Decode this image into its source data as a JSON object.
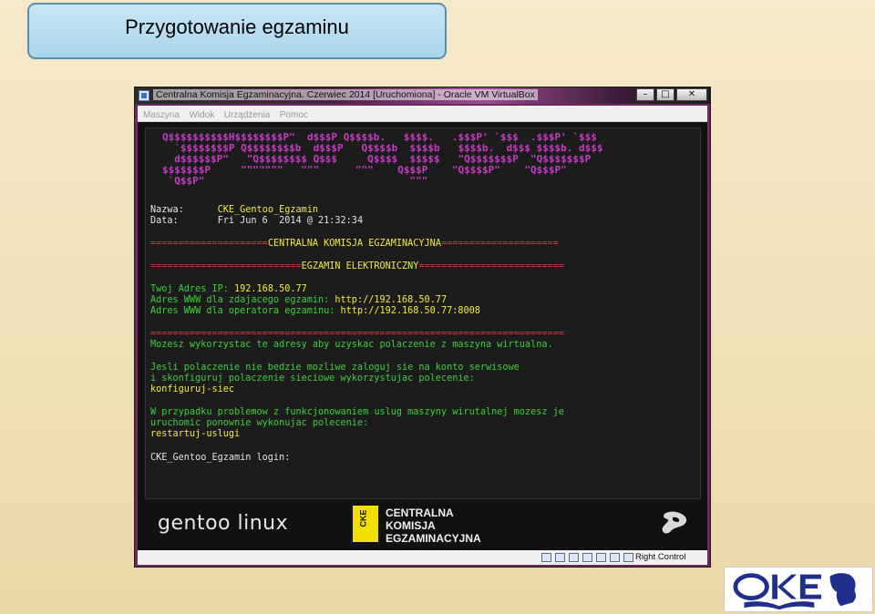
{
  "slide": {
    "title": "Przygotowanie egzaminu"
  },
  "window": {
    "title": "Centralna Komisja Egzaminacyjna. Czerwiec 2014 [Uruchomiona] - Oracle VM VirtualBox",
    "controls": {
      "minimize": "–",
      "maximize": "□",
      "close": "✕"
    }
  },
  "menubar": {
    "items": [
      "Maszyna",
      "Widok",
      "Urządzenia",
      "Pomoc"
    ]
  },
  "console": {
    "ascii_banner": [
      "Q$$$$$$$$$$H$$$$$$$$P\"  d$$$P Q$$$$b.   $$$$.   .$$$P' `$$$  .$$$P' `$$$",
      "  `$$$$$$$$P Q$$$$$$$$b  d$$$P   Q$$$$b  $$$$b   $$$$b.  d$$$ $$$$b. d$$$",
      "  d$$$$$$P\"   \"Q$$$$$$$$ Q$$$     Q$$$$  $$$$$   \"Q$$$$$$$P  \"Q$$$$$$$P",
      "$$$$$$$P     \"\"\"\"\"\"\"   \"\"\"      \"\"\"    Q$$$P    \"Q$$$$P\"    \"Q$$$P\"",
      " `Q$$P\"                                  \"\"\""
    ],
    "name_label": "Nazwa:",
    "name_value": "CKE_Gentoo_Egzamin",
    "date_label": "Data:",
    "date_value": "Fri Jun 6  2014 @ 21:32:34",
    "sep1_left": "=====================",
    "sep1_center": "CENTRALNA KOMISJA EGZAMINACYJNA",
    "sep1_right": "=====================",
    "sep2_left": "===========================",
    "sep2_center": "EGZAMIN ELEKTRONICZNY",
    "sep2_right": "==========================",
    "ip_label": "Twoj Adres IP: ",
    "ip_value": "192.168.50.77",
    "www_label": "Adres WWW dla zdajacego egzamin: ",
    "www_value": "http://192.168.50.77",
    "www_op_label": "Adres WWW dla operatora egzaminu: ",
    "www_op_value": "http://192.168.50.77:8008",
    "sep3": "==========================================================================",
    "msg1": "Mozesz wykorzystac te adresy aby uzyskac polaczenie z maszyna wirtualna.",
    "msg2_l1": "Jesli polaczenie nie bedzie mozliwe zaloguj sie na konto serwisowe",
    "msg2_l2": "i skonfiguruj polaczenie sieciowe wykorzystujac polecenie:",
    "cmd1": "konfiguruj-siec",
    "msg3_l1": "W przypadku problemow z funkcjonowaniem uslug maszyny wirutalnej mozesz je",
    "msg3_l2": "uruchomic ponownie wykonujac polecenie:",
    "cmd2": "restartuj-uslugi",
    "login_prompt": "CKE_Gentoo_Egzamin login:"
  },
  "splash": {
    "gentoo": "gentoo linux",
    "cke_l1": "CENTRALNA",
    "cke_l2": "KOMISJA",
    "cke_l3": "EGZAMINACYJNA"
  },
  "statusbar": {
    "hostkey": "Right Control"
  },
  "colors": {
    "console_green": "#3dcf3a",
    "console_yellow": "#f2ea40",
    "console_red": "#d8383f",
    "ascii_magenta": "#c53cc3"
  }
}
